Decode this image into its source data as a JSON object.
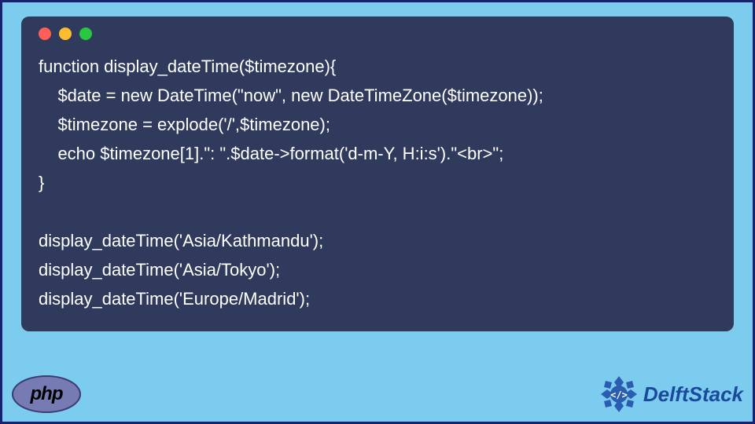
{
  "code": {
    "lines": [
      "function display_dateTime($timezone){",
      "    $date = new DateTime(\"now\", new DateTimeZone($timezone));",
      "    $timezone = explode('/',$timezone);",
      "    echo $timezone[1].\": \".$date->format('d-m-Y, H:i:s').\"<br>\";",
      "}",
      "",
      "display_dateTime('Asia/Kathmandu');",
      "display_dateTime('Asia/Tokyo');",
      "display_dateTime('Europe/Madrid');"
    ]
  },
  "footer": {
    "php_label": "php",
    "brand": "DelftStack"
  }
}
